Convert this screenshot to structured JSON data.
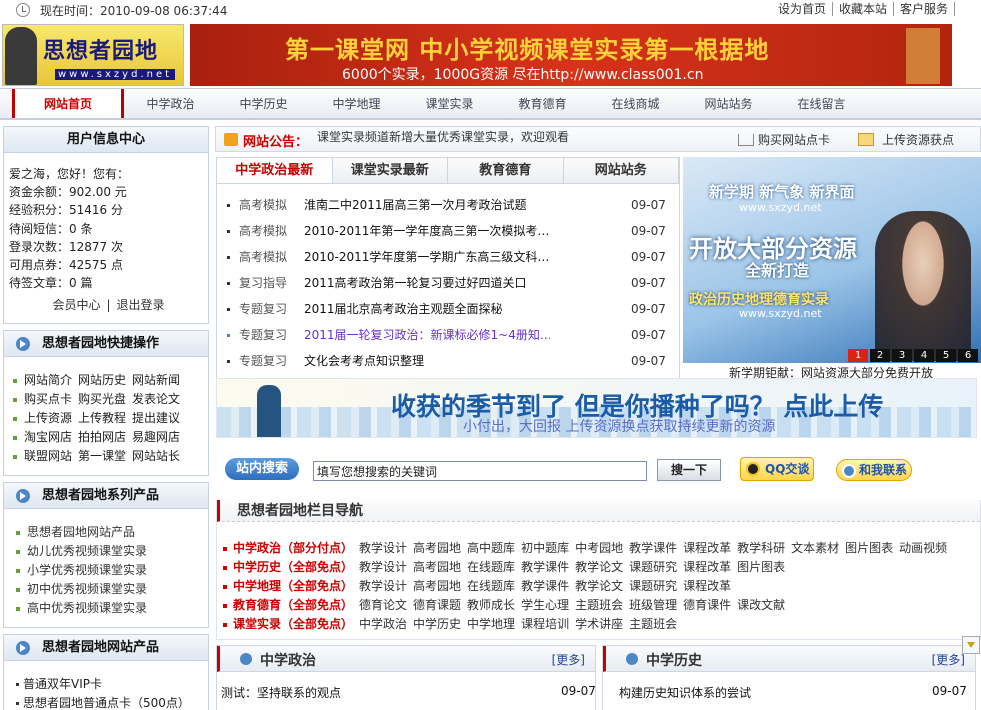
{
  "topbar": {
    "time_label": "现在时间：2010-09-08 06:37:44",
    "links": [
      "设为首页",
      "收藏本站",
      "客户服务"
    ]
  },
  "header": {
    "logo_name": "思想者园地",
    "logo_url": "www.sxzyd.net",
    "banner_title": "第一课堂网 中小学视频课堂实录第一根据地",
    "banner_sub": "6000个实录，1000G资源 尽在http://www.class001.cn"
  },
  "nav": {
    "items": [
      "网站首页",
      "中学政治",
      "中学历史",
      "中学地理",
      "课堂实录",
      "教育德育",
      "在线商城",
      "网站站务",
      "在线留言"
    ]
  },
  "user_center": {
    "title": "用户信息中心",
    "greeting": "爱之海，您好！您有：",
    "lines": [
      "资金余额：902.00 元",
      "经验积分：51416 分",
      "待阅短信：0 条",
      "登录次数：12877 次",
      "可用点券：42575 点",
      "待签文章：0 篇"
    ],
    "member_center": "会员中心",
    "logout": "退出登录"
  },
  "quick_ops": {
    "title": "思想者园地快捷操作",
    "rows": [
      [
        "网站简介",
        "网站历史",
        "网站新闻"
      ],
      [
        "购买点卡",
        "购买光盘",
        "发表论文"
      ],
      [
        "上传资源",
        "上传教程",
        "提出建议"
      ],
      [
        "淘宝网店",
        "拍拍网店",
        "易趣网店"
      ],
      [
        "联盟网站",
        "第一课堂",
        "网站站长"
      ]
    ]
  },
  "series": {
    "title": "思想者园地系列产品",
    "items": [
      "思想者园地网站产品",
      "幼儿优秀视频课堂实录",
      "小学优秀视频课堂实录",
      "初中优秀视频课堂实录",
      "高中优秀视频课堂实录"
    ]
  },
  "products": {
    "title": "思想者园地网站产品",
    "items": [
      "普通双年VIP卡",
      "思想者园地普通点卡（500点）"
    ]
  },
  "notice": {
    "label": "网站公告：",
    "text": "课堂实录频道新增大量优秀课堂实录，欢迎观看",
    "buy": "购买网站点卡",
    "upload": "上传资源获点"
  },
  "news": {
    "tabs": [
      "中学政治最新",
      "课堂实录最新",
      "教育德育",
      "网站站务"
    ],
    "items": [
      {
        "cat": "高考模拟",
        "title": "淮南二中2011届高三第一次月考政治试题",
        "date": "09-07"
      },
      {
        "cat": "高考模拟",
        "title": "2010-2011年第一学年度高三第一次模拟考…",
        "date": "09-07"
      },
      {
        "cat": "高考模拟",
        "title": "2010-2011学年度第一学期广东高三级文科…",
        "date": "09-07"
      },
      {
        "cat": "复习指导",
        "title": "2011高考政治第一轮复习要过好四道关口",
        "date": "09-07"
      },
      {
        "cat": "专题复习",
        "title": "2011届北京高考政治主观题全面探秘",
        "date": "09-07"
      },
      {
        "cat": "专题复习",
        "title": "2011届一轮复习政治：新课标必修1~4册知…",
        "date": "09-07"
      },
      {
        "cat": "专题复习",
        "title": "文化会考考点知识整理",
        "date": "09-07"
      }
    ]
  },
  "promo": {
    "line1": "新学期 新气象 新界面",
    "line2": "www.sxzyd.net",
    "line3": "开放大部分资源",
    "line4": "全新打造",
    "line5": "政治历史地理德育实录",
    "line6": "www.sxzyd.net",
    "pages": [
      "1",
      "2",
      "3",
      "4",
      "5",
      "6"
    ],
    "caption": "新学期钜献：网站资源大部分免费开放"
  },
  "harvest": {
    "title": "收获的季节到了 但是你播种了吗？ 点此上传",
    "sub": "小付出，大回报 上传资源换点获取持续更新的资源"
  },
  "search": {
    "label": "站内搜索",
    "value": "填写您想搜索的关键词",
    "button": "搜一下",
    "qq": "QQ交谈",
    "contact": "和我联系"
  },
  "colnav": {
    "title": "思想者园地栏目导航",
    "rows": [
      {
        "sec": "中学政治（部分付点）",
        "links": [
          "教学设计",
          "高考园地",
          "高中题库",
          "初中题库",
          "中考园地",
          "教学课件",
          "课程改革",
          "教学科研",
          "文本素材",
          "图片图表",
          "动画视频"
        ]
      },
      {
        "sec": "中学历史（全部免点）",
        "links": [
          "教学设计",
          "高考园地",
          "在线题库",
          "教学课件",
          "教学论文",
          "课题研究",
          "课程改革",
          "图片图表"
        ]
      },
      {
        "sec": "中学地理（全部免点）",
        "links": [
          "教学设计",
          "高考园地",
          "在线题库",
          "教学课件",
          "教学论文",
          "课题研究",
          "课程改革"
        ]
      },
      {
        "sec": "教育德育（全部免点）",
        "links": [
          "德育论文",
          "德育课题",
          "教师成长",
          "学生心理",
          "主题班会",
          "班级管理",
          "德育课件",
          "课改文献"
        ]
      },
      {
        "sec": "课堂实录（全部免点）",
        "links": [
          "中学政治",
          "中学历史",
          "中学地理",
          "课程培训",
          "学术讲座",
          "主题班会"
        ]
      }
    ]
  },
  "panels": [
    {
      "title": "中学政治",
      "more": "[更多]",
      "item": "测试：坚持联系的观点",
      "date": "09-07"
    },
    {
      "title": "中学历史",
      "more": "[更多]",
      "item": "构建历史知识体系的尝试",
      "date": "09-07"
    }
  ]
}
